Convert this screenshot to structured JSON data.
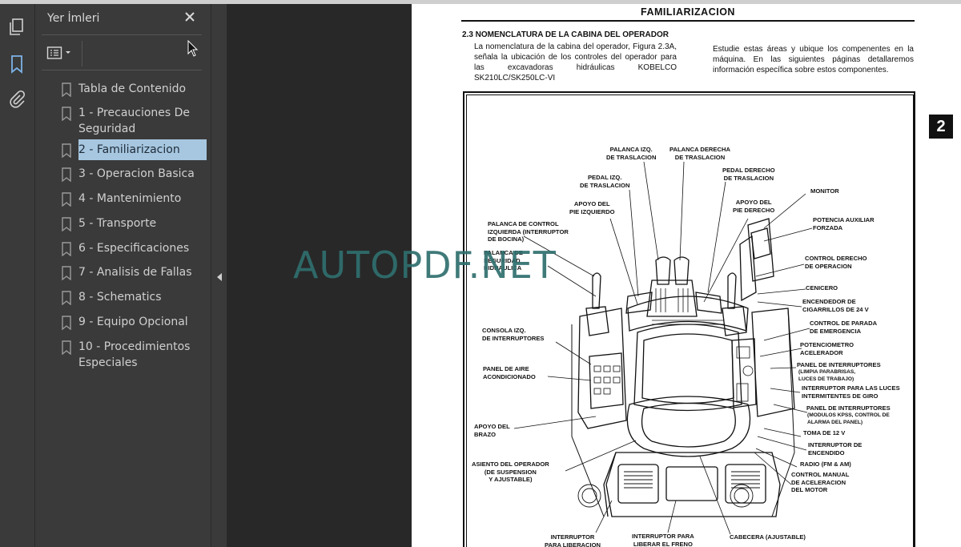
{
  "sidebar": {
    "title": "Yer İmleri",
    "items": [
      {
        "label": "Tabla de Contenido"
      },
      {
        "label": "1 - Precauciones De Seguridad"
      },
      {
        "label": "2 - Familiarizacion"
      },
      {
        "label": "3 - Operacion Basica"
      },
      {
        "label": "4 - Mantenimiento"
      },
      {
        "label": "5 - Transporte"
      },
      {
        "label": "6 - Especificaciones"
      },
      {
        "label": "7 - Analisis de Fallas"
      },
      {
        "label": "8 - Schematics"
      },
      {
        "label": "9 - Equipo Opcional"
      },
      {
        "label": "10 - Procedimientos Especiales"
      }
    ],
    "selected_index": 2
  },
  "document": {
    "header": "FAMILIARIZACION",
    "section_title": "2.3 NOMENCLATURA DE LA CABINA DEL OPERADOR",
    "para_left": "La nomenclatura de la cabina del operador, Figura 2.3A, señala la ubicación de los controles del operador para las excavadoras hidráulicas KOBELCO SK210LC/SK250LC-VI",
    "para_right": "Estudie estas áreas y ubique los compenentes en la máquina. En las siguientes páginas detallaremos información específica sobre estos componentes.",
    "chapter_tab": "2",
    "labels": {
      "palanca_izq_traslacion": "PALANCA IZQ.\nDE TRASLACION",
      "palanca_der_traslacion": "PALANCA DERECHA\nDE TRASLACION",
      "pedal_izq": "PEDAL IZQ.\nDE TRASLACION",
      "pedal_der": "PEDAL DERECHO\nDE TRASLACION",
      "apoyo_pie_izq": "APOYO DEL\nPIE IZQUIERDO",
      "apoyo_pie_der": "APOYO DEL\nPIE DERECHO",
      "monitor": "MONITOR",
      "palanca_control_izq": "PALANCA DE CONTROL\nIZQUIERDA (INTERRUPTOR\nDE BOCINA)",
      "palanca_seguridad": "PALANCA DE\nSEGURIDAD\nHIDRAULICA",
      "potencia_auxiliar": "POTENCIA AUXILIAR\nFORZADA",
      "control_der": "CONTROL DERECHO\nDE OPERACION",
      "cenicero": "CENICERO",
      "encendedor": "ENCENDEDOR DE\nCIGARRILLOS DE 24 V",
      "parada_emergencia": "CONTROL DE PARADA\nDE EMERGENCIA",
      "potenciometro": "POTENCIOMETRO\nACELERADOR",
      "consola_izq": "CONSOLA IZQ.\nDE INTERRUPTORES",
      "panel_interruptores_1": "PANEL DE INTERRUPTORES",
      "panel_interruptores_1_sub": "(LIMPIA PARABRISAS,\nLUCES DE TRABAJO)",
      "panel_aire": "PANEL DE AIRE\nACONDICIONADO",
      "luces_giro": "INTERRUPTOR PARA LAS LUCES\nINTERMITENTES DE GIRO",
      "panel_interruptores_2": "PANEL DE INTERRUPTORES",
      "panel_interruptores_2_sub": "(MODULOS KPSS, CONTROL DE\nALARMA DEL PANEL)",
      "apoyo_brazo": "APOYO DEL\nBRAZO",
      "toma_12v": "TOMA DE 12 V",
      "interruptor_encendido": "INTERRUPTOR DE\nENCENDIDO",
      "asiento": "ASIENTO DEL OPERADOR\n(DE SUSPENSION\nY AJUSTABLE)",
      "radio": "RADIO (FM & AM)",
      "control_manual": "CONTROL MANUAL\nDE ACELERACION\nDEL MOTOR",
      "int_liberacion": "INTERRUPTOR\nPARA LIBERACION",
      "int_freno": "INTERRUPTOR PARA\nLIBERAR EL FRENO",
      "cabecera": "CABECERA (AJUSTABLE)"
    }
  },
  "watermark": "AUTOPDF.NET",
  "colors": {
    "panel_bg": "#3a3a3a",
    "viewer_bg": "#282828",
    "selection": "#a7c7e0",
    "watermark": "#2f6f6e"
  }
}
